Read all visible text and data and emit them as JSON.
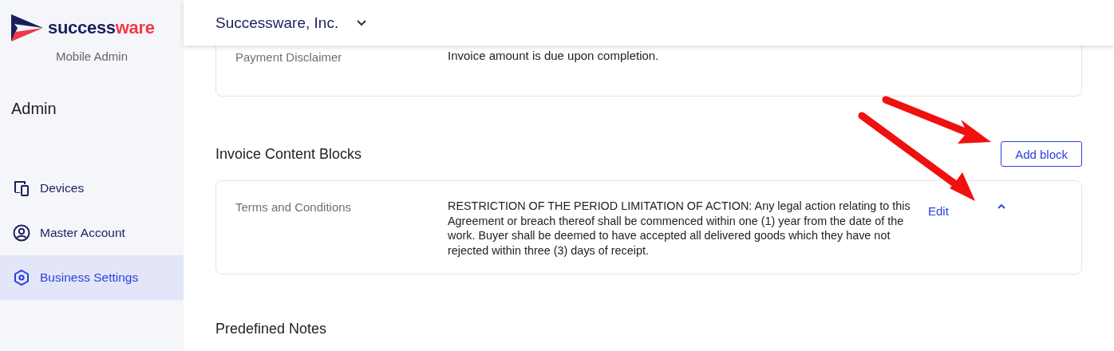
{
  "brand": {
    "word_dark": "success",
    "word_accent": "ware",
    "subtitle": "Mobile Admin"
  },
  "sidebar": {
    "title": "Admin",
    "items": [
      {
        "label": "Devices",
        "kind": "devices",
        "selected": false
      },
      {
        "label": "Master Account",
        "kind": "account",
        "selected": false
      },
      {
        "label": "Business Settings",
        "kind": "settings",
        "selected": true
      }
    ]
  },
  "header": {
    "company": "Successware, Inc."
  },
  "top_card": {
    "rows": [
      {
        "label": "Payment Disclaimer",
        "value": "Invoice amount is due upon completion."
      }
    ]
  },
  "sections": [
    {
      "title": "Invoice Content Blocks",
      "action": "Add block",
      "blocks": [
        {
          "label": "Terms and Conditions",
          "value": "RESTRICTION OF THE PERIOD LIMITATION OF ACTION: Any legal action relating to this Agreement or breach thereof shall be commenced within one (1) year from the date of the work. Buyer shall be deemed to have accepted all delivered goods which they have not rejected within three (3) days of receipt.",
          "edit": "Edit",
          "expanded": true
        }
      ]
    },
    {
      "title": "Predefined Notes"
    }
  ]
}
